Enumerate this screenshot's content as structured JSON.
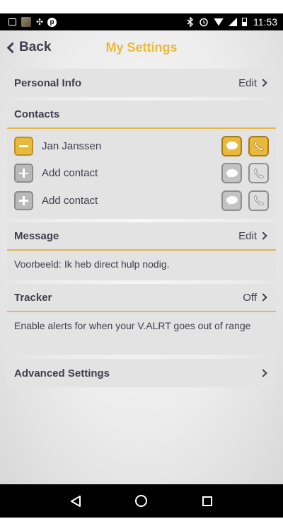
{
  "status_bar": {
    "time": "11:53",
    "icons": [
      "picture-icon",
      "thumbnail-icon",
      "dots-icon",
      "pinterest-icon",
      "bluetooth-icon",
      "alarm-icon",
      "wifi-icon",
      "signal-icon",
      "battery-icon"
    ]
  },
  "header": {
    "back_label": "Back",
    "title": "My Settings"
  },
  "personal_info": {
    "title": "Personal Info",
    "action": "Edit"
  },
  "contacts": {
    "title": "Contacts",
    "items": [
      {
        "name": "Jan Janssen",
        "state": "set"
      },
      {
        "name": "Add contact",
        "state": "empty"
      },
      {
        "name": "Add contact",
        "state": "empty"
      }
    ]
  },
  "message": {
    "title": "Message",
    "action": "Edit",
    "text": "Voorbeeld: Ik heb direct hulp nodig."
  },
  "tracker": {
    "title": "Tracker",
    "action": "Off",
    "text": "Enable alerts for when your V.ALRT goes out of range"
  },
  "advanced": {
    "title": "Advanced Settings"
  },
  "colors": {
    "accent": "#e8b93b",
    "text": "#3e3e4e",
    "card": "#e3e3e3"
  },
  "nav_bar": {
    "icons": [
      "back-triangle-icon",
      "home-circle-icon",
      "recent-square-icon"
    ]
  }
}
